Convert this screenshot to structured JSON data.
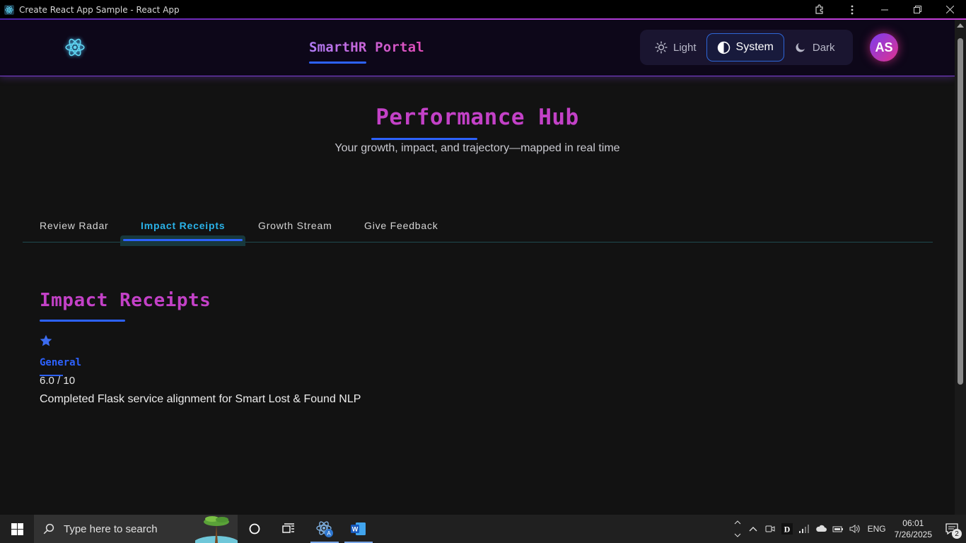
{
  "window": {
    "title": "Create React App Sample - React App"
  },
  "header": {
    "brand": "SmartHR Portal",
    "theme_options": [
      {
        "label": "Light",
        "icon": "sun-icon",
        "active": false
      },
      {
        "label": "System",
        "icon": "half-circle-icon",
        "active": true
      },
      {
        "label": "Dark",
        "icon": "moon-icon",
        "active": false
      }
    ],
    "avatar_initials": "AS"
  },
  "hero": {
    "title": "Performance Hub",
    "subtitle": "Your growth, impact, and trajectory—mapped in real time"
  },
  "tabs": [
    {
      "label": "Review Radar",
      "active": false
    },
    {
      "label": "Impact Receipts",
      "active": true
    },
    {
      "label": "Growth Stream",
      "active": false
    },
    {
      "label": "Give Feedback",
      "active": false
    }
  ],
  "section": {
    "title": "Impact Receipts",
    "receipt": {
      "icon": "star-icon",
      "category": "General",
      "score": "6.0 / 10",
      "description": "Completed Flask service alignment for Smart Lost & Found NLP"
    }
  },
  "taskbar": {
    "search_placeholder": "Type here to search",
    "language": "ENG",
    "time": "06:01",
    "date": "7/26/2025",
    "notification_count": "2"
  },
  "colors": {
    "accent_blue": "#2d62ff",
    "title_magenta": "#c341c7",
    "tab_active": "#2ab2e8",
    "header_bg": "#0d0719",
    "page_bg": "#121212"
  }
}
